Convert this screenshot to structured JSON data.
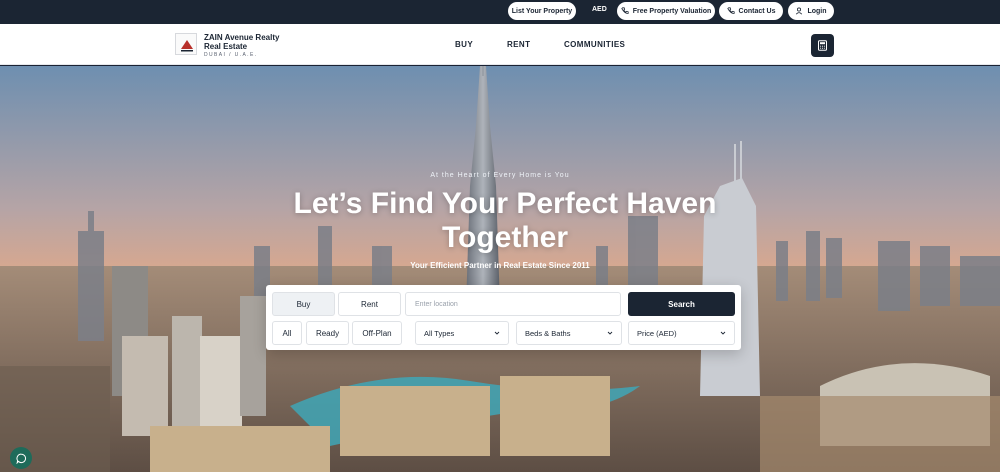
{
  "topbar": {
    "list_property": "List Your Property",
    "currency": "AED",
    "valuation": "Free Property Valuation",
    "contact": "Contact Us",
    "login": "Login"
  },
  "nav": {
    "logo_line1": "ZAIN Avenue Realty",
    "logo_line2": "Real Estate",
    "logo_sub": "DUBAI / U.A.E.",
    "links": [
      "BUY",
      "RENT",
      "COMMUNITIES"
    ]
  },
  "hero": {
    "tagline": "At the Heart of Every Home is You",
    "headline": "Let’s Find Your Perfect Haven Together",
    "subline": "Your Efficient Partner in Real Estate Since 2011"
  },
  "search": {
    "mode_buy": "Buy",
    "mode_rent": "Rent",
    "location_placeholder": "Enter location",
    "search_label": "Search",
    "status_all": "All",
    "status_ready": "Ready",
    "status_offplan": "Off-Plan",
    "type_select": "All Types",
    "beds_select": "Beds & Baths",
    "price_select": "Price (AED)"
  },
  "colors": {
    "brand_dark": "#1b2533",
    "chat_green": "#1e6b5a"
  }
}
